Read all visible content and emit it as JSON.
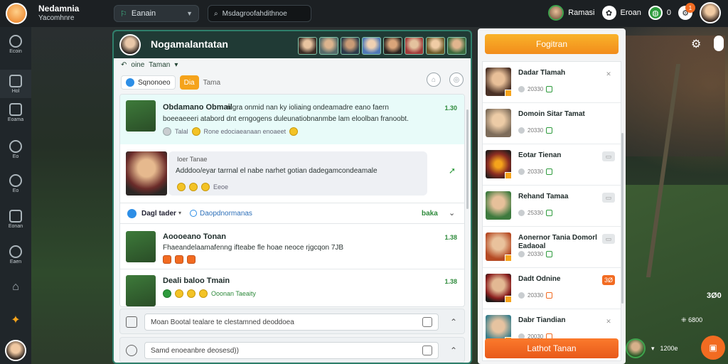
{
  "app": {
    "name": "Nedamnia",
    "subtitle": "Yacomhnre"
  },
  "topbar": {
    "workspace": "Eanain",
    "search_placeholder": "Msdagroofahdithnoe",
    "user_chip": "Ramasi",
    "mode_chip": "Eroan",
    "count": "0",
    "notif_badge": "1"
  },
  "leftnav": [
    {
      "label": "Ecoin",
      "icon": "compass-icon"
    },
    {
      "label": "Hol",
      "icon": "grid-icon"
    },
    {
      "label": "Eoama",
      "icon": "folder-icon"
    },
    {
      "label": "Eo",
      "icon": "search-icon"
    },
    {
      "label": "Eo",
      "icon": "search-icon"
    },
    {
      "label": "Eonan",
      "icon": "camera-icon"
    },
    {
      "label": "Eaen",
      "icon": "gear-icon"
    },
    {
      "label": "",
      "icon": "home-icon"
    },
    {
      "label": "",
      "icon": "flame-icon"
    }
  ],
  "chat": {
    "title": "Nogamalantatan",
    "sub_label": "oine",
    "sub_value": "Taman",
    "filter_active": "Sqnonoeo",
    "filter_badge": "Dia",
    "filter_plain": "Tama",
    "messages": [
      {
        "name": "Obdamano Obmail",
        "body_1": "nigra onmid nan ky ioliaing ondeamadre eano faern",
        "body_2": "boeeaeeeri atabord dnt erngogens duleunatiobnanmbe lam eloolban franoobt.",
        "meta": "Talal",
        "meta_2": "Rone edociaeanaan enoaeet",
        "time": "1.30"
      },
      {
        "name": "Ioer Tanae",
        "body_1": "Adddoo/eyar tarrnal el nabe narhet gotian dadegamcondeamale",
        "meta": "Eeoe",
        "time": ""
      },
      {
        "name": "Dagl tader",
        "body_1": "Daopdnormanas",
        "meta": "baka",
        "time": ""
      },
      {
        "name": "Aoooeano Tonan",
        "body_1": "Fhaeandelaamafenng ifteabe fle hoae neoce rjgcqon 7JB",
        "meta": "",
        "time": "1.38"
      },
      {
        "name": "Deali baloo Tmain",
        "body_1": "",
        "meta": "Ooonan Taeaity",
        "time": "1.38"
      }
    ],
    "composer_1": "Moan Bootal tealare te clestamned deoddoea",
    "composer_2": "Samd enoeanbre deosesd))"
  },
  "right_panel": {
    "top_button": "Fogitran",
    "bottom_button": "Lathot Tanan",
    "items": [
      {
        "name": "Dadar Tlamah",
        "score": "20330",
        "action": "✕"
      },
      {
        "name": "Domoin Sitar Tamat",
        "score": "20330",
        "action": ""
      },
      {
        "name": "Eotar Tienan",
        "score": "20330",
        "action": ""
      },
      {
        "name": "Rehand Tamaa",
        "score": "25330",
        "action": ""
      },
      {
        "name": "Aonernor Tania Domorl Eadaoal",
        "score": "20330",
        "action": ""
      },
      {
        "name": "Dadt Odnine",
        "score": "20330",
        "action": "3Ø"
      },
      {
        "name": "Dabr Tiandian",
        "score": "20030",
        "action": "✕"
      }
    ]
  },
  "side": {
    "score": "3Ø0",
    "stat": "6800",
    "bottom_stat": "1200e"
  },
  "colors": {
    "accent": "#f5a31b",
    "brand_dark": "#203a35",
    "online": "#2e9b3d"
  }
}
